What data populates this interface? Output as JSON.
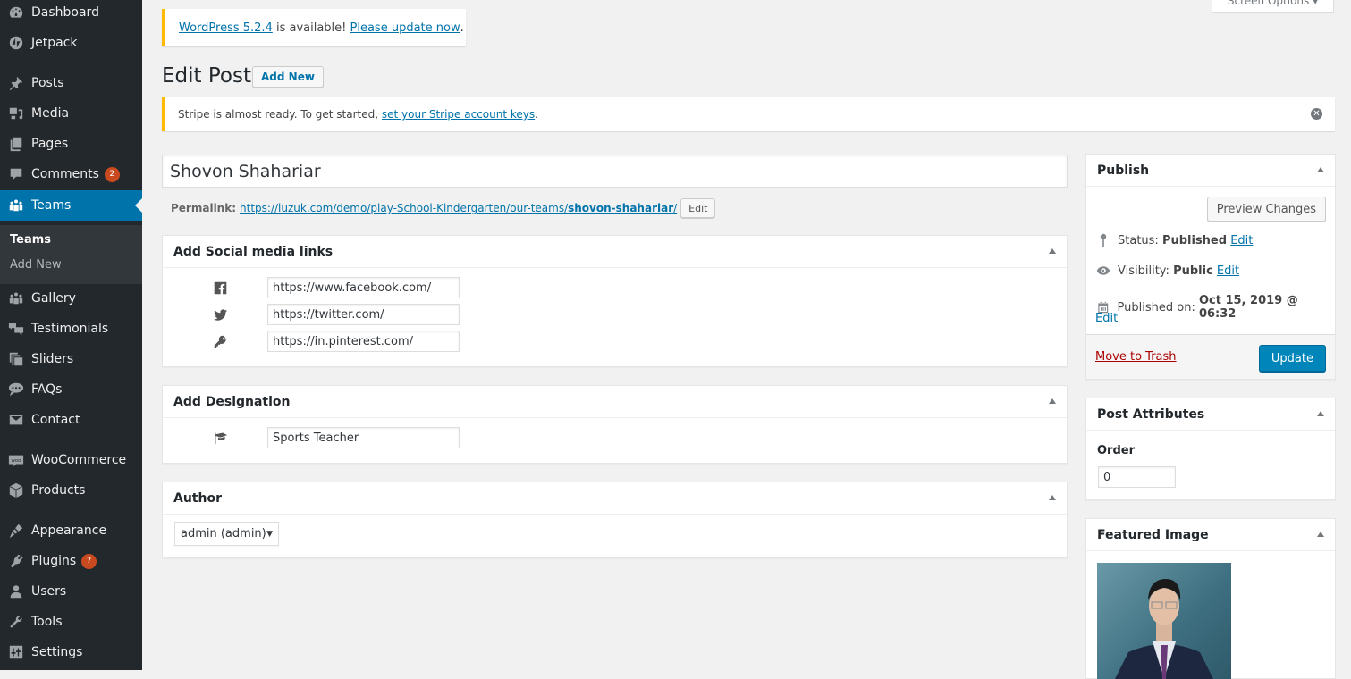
{
  "sidebar": {
    "items": [
      {
        "label": "Dashboard",
        "icon": "dashboard-icon"
      },
      {
        "label": "Jetpack",
        "icon": "jetpack-icon"
      },
      {
        "label": "Posts",
        "icon": "pin-icon"
      },
      {
        "label": "Media",
        "icon": "media-icon"
      },
      {
        "label": "Pages",
        "icon": "pages-icon"
      },
      {
        "label": "Comments",
        "icon": "comment-icon",
        "badge": "2"
      },
      {
        "label": "Teams",
        "icon": "groups-icon",
        "active": true
      },
      {
        "label": "Gallery",
        "icon": "groups-icon"
      },
      {
        "label": "Testimonials",
        "icon": "testimonial-icon"
      },
      {
        "label": "Sliders",
        "icon": "slides-icon"
      },
      {
        "label": "FAQs",
        "icon": "chat-bubble-icon"
      },
      {
        "label": "Contact",
        "icon": "envelope-icon"
      },
      {
        "label": "WooCommerce",
        "icon": "woo-icon"
      },
      {
        "label": "Products",
        "icon": "box-icon"
      },
      {
        "label": "Appearance",
        "icon": "brush-icon"
      },
      {
        "label": "Plugins",
        "icon": "plugin-icon",
        "badge": "7"
      },
      {
        "label": "Users",
        "icon": "user-icon"
      },
      {
        "label": "Tools",
        "icon": "wrench-icon"
      },
      {
        "label": "Settings",
        "icon": "settings-icon"
      }
    ],
    "submenu": [
      {
        "label": "Teams",
        "current": true
      },
      {
        "label": "Add New"
      }
    ]
  },
  "screen_options": "Screen Options ▾",
  "update_notice": {
    "link1": "WordPress 5.2.4",
    "text": " is available! ",
    "link2": "Please update now",
    "tail": "."
  },
  "page": {
    "title": "Edit Post",
    "add_new": "Add New"
  },
  "stripe_notice": {
    "text": "Stripe is almost ready. To get started, ",
    "link": "set your Stripe account keys",
    "tail": "."
  },
  "post": {
    "title": "Shovon Shahariar",
    "permalink_label": "Permalink:",
    "permalink_base": "https://luzuk.com/demo/play-School-Kindergarten/our-teams/",
    "permalink_slug": "shovon-shahariar",
    "permalink_tail": "/",
    "permalink_edit": "Edit"
  },
  "social": {
    "title": "Add Social media links",
    "links": [
      {
        "icon": "facebook-icon",
        "value": "https://www.facebook.com/"
      },
      {
        "icon": "twitter-icon",
        "value": "https://twitter.com/"
      },
      {
        "icon": "key-icon",
        "value": "https://in.pinterest.com/"
      }
    ]
  },
  "designation": {
    "title": "Add Designation",
    "value": "Sports Teacher"
  },
  "author": {
    "title": "Author",
    "selected": "admin (admin)"
  },
  "publish": {
    "title": "Publish",
    "preview": "Preview Changes",
    "status_label": "Status: ",
    "status_value": "Published",
    "visibility_label": "Visibility: ",
    "visibility_value": "Public",
    "published_label": "Published on: ",
    "published_value": "Oct 15, 2019 @ 06:32",
    "edit": "Edit",
    "trash": "Move to Trash",
    "update": "Update"
  },
  "attributes": {
    "title": "Post Attributes",
    "order_label": "Order",
    "order_value": "0"
  },
  "featured": {
    "title": "Featured Image"
  },
  "colors": {
    "accent": "#0073aa",
    "sidebar": "#23282d",
    "badge": "#ca4a1f",
    "notice_warning": "#ffb900",
    "trash": "#a00"
  }
}
